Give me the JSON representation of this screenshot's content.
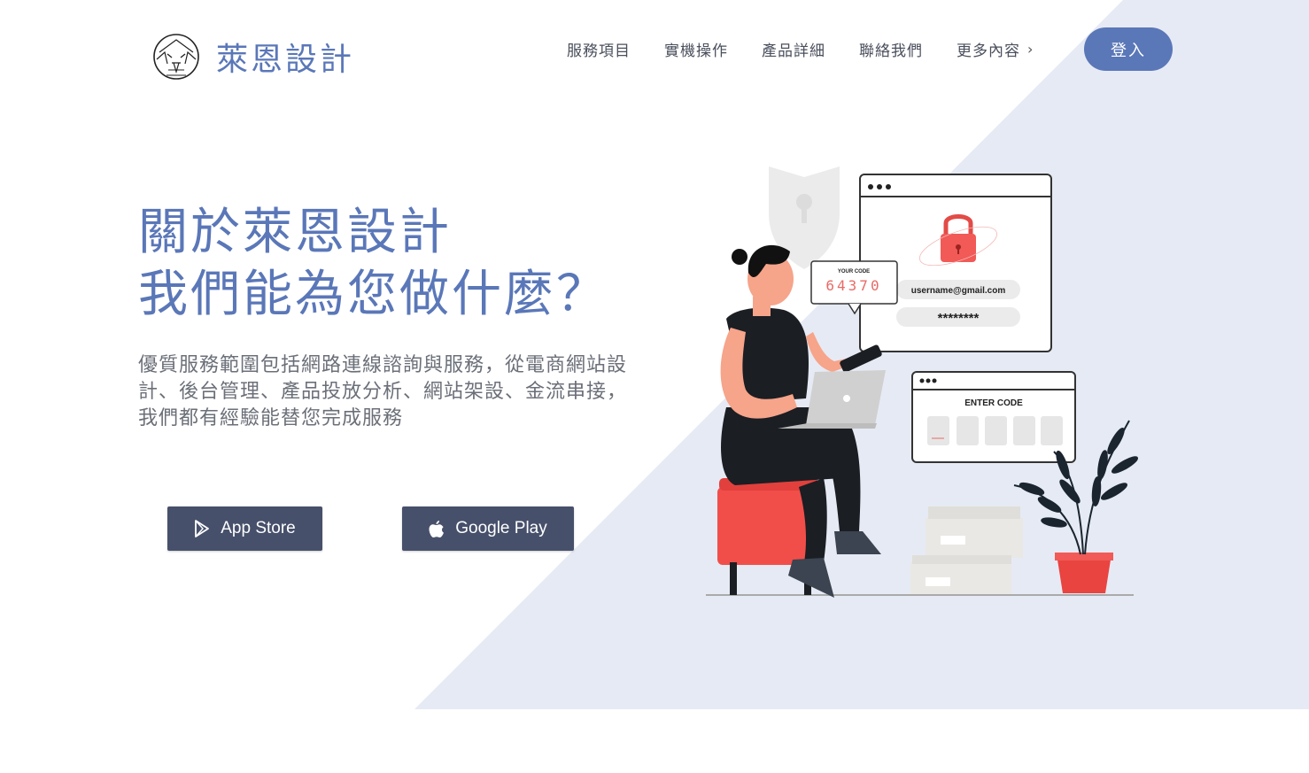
{
  "brand": {
    "name": "萊恩設計",
    "logo_icon": "lion-head-logo",
    "accent_color": "#5a77b8",
    "background_triangle_color": "#e6eaf4"
  },
  "nav": {
    "items": [
      {
        "label": "服務項目"
      },
      {
        "label": "實機操作"
      },
      {
        "label": "產品詳細"
      },
      {
        "label": "聯絡我們"
      },
      {
        "label": "更多內容",
        "icon": "chevron-right-icon"
      }
    ],
    "login_label": "登入"
  },
  "hero": {
    "title_line1": "關於萊恩設計",
    "title_line2": "我們能為您做什麼？",
    "description": "優質服務範圍包括網路連線諮詢與服務，從電商網站設計、後台管理、產品投放分析、網站架設、金流串接，我們都有經驗能替您完成服務"
  },
  "buttons": {
    "app_store": {
      "label": "App Store",
      "icon": "play-icon"
    },
    "google_play": {
      "label": "Google Play",
      "icon": "apple-icon"
    },
    "color": "#47506b"
  },
  "illustration": {
    "code_label": "YOUR CODE",
    "code_value": "64370",
    "email": "username@gmail.com",
    "password": "********",
    "enter_code_label": "ENTER CODE"
  }
}
